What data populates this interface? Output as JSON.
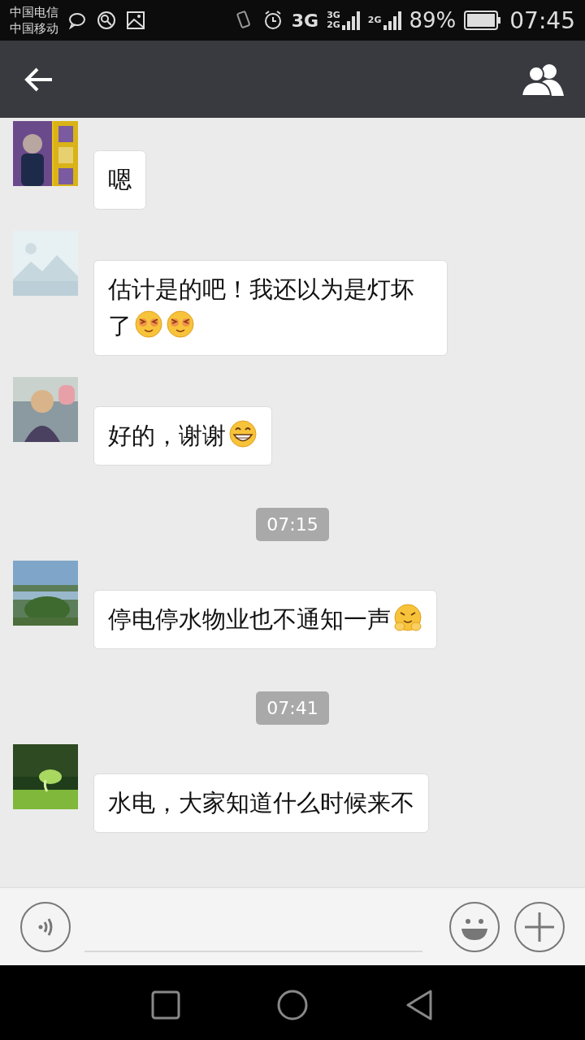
{
  "status_bar": {
    "carriers": [
      "中国电信",
      "中国移动"
    ],
    "network": "3G",
    "signal_labels": [
      {
        "top": "3G",
        "bottom": "2G"
      },
      {
        "top": "2G"
      }
    ],
    "battery": "89%",
    "time": "07:45"
  },
  "messages": [
    {
      "kind": "message",
      "text": "嗯"
    },
    {
      "kind": "message",
      "text": "估计是的吧！我还以为是灯坏了",
      "emojis": [
        {
          "kind": "blush"
        },
        {
          "kind": "blush"
        }
      ]
    },
    {
      "kind": "message",
      "text": "好的，谢谢",
      "emojis": [
        {
          "kind": "grin"
        }
      ]
    },
    {
      "kind": "time",
      "text": "07:15"
    },
    {
      "kind": "message",
      "text": "停电停水物业也不通知一声",
      "emojis": [
        {
          "kind": "hug"
        }
      ]
    },
    {
      "kind": "time",
      "text": "07:41"
    },
    {
      "kind": "message",
      "text": "水电，大家知道什么时候来不"
    }
  ]
}
